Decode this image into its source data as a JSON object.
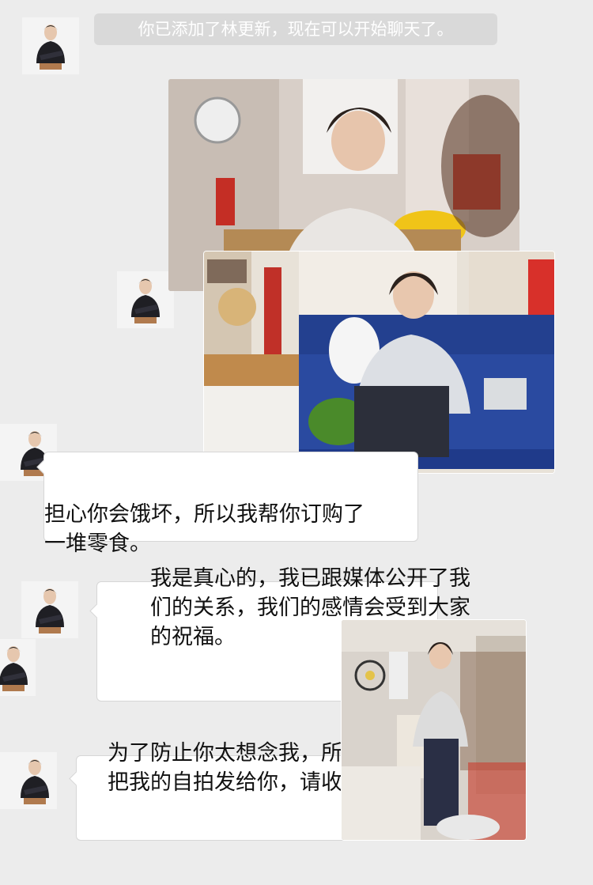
{
  "system_notice": "你已添加了林更新，现在可以开始聊天了。",
  "messages": [
    {
      "type": "image",
      "content": "photo-studio-desk"
    },
    {
      "type": "image",
      "content": "photo-blue-sofa"
    },
    {
      "type": "text",
      "text": "担心你会饿坏，所以我帮你订购了\n一堆零食。"
    },
    {
      "type": "text",
      "text": "我是真心的，我已跟媒体公开了我\n们的关系，我们的感情会受到大家\n的祝福。"
    },
    {
      "type": "image",
      "content": "photo-standing-room"
    },
    {
      "type": "text",
      "text": "为了防止你太想念我，所\n把我的自拍发给你，请收"
    }
  ],
  "colors": {
    "background": "#ececec",
    "bubble": "#ffffff",
    "notice_bg": "#d9d9d9"
  },
  "icons": {
    "avatar": "contact-avatar-photo"
  }
}
